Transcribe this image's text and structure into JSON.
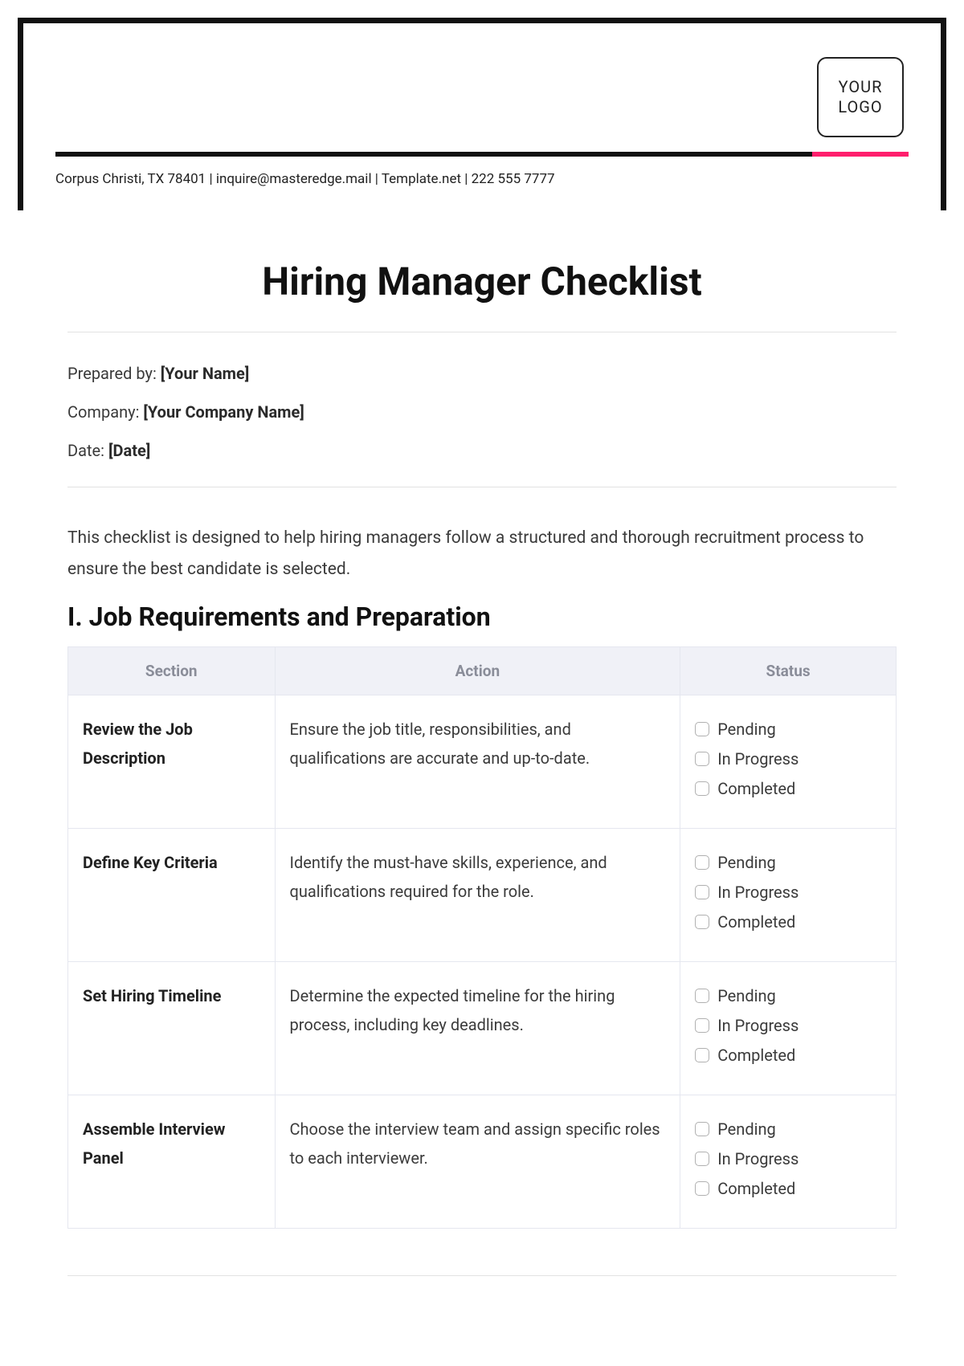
{
  "header": {
    "logo_line1": "YOUR",
    "logo_line2": "LOGO",
    "contact": "Corpus Christi, TX 78401 | inquire@masteredge.mail | Template.net | 222 555 7777"
  },
  "title": "Hiring Manager Checklist",
  "meta": {
    "prepared_label": "Prepared by: ",
    "prepared_value": "[Your Name]",
    "company_label": "Company: ",
    "company_value": "[Your Company Name]",
    "date_label": "Date: ",
    "date_value": "[Date]"
  },
  "intro": "This checklist is designed to help hiring managers follow a structured and thorough recruitment process to ensure the best candidate is selected.",
  "section1": {
    "heading": "I. Job Requirements and Preparation",
    "columns": {
      "section": "Section",
      "action": "Action",
      "status": "Status"
    },
    "status_options": [
      "Pending",
      "In Progress",
      "Completed"
    ],
    "rows": [
      {
        "section": "Review the Job Description",
        "action": "Ensure the job title, responsibilities, and qualifications are accurate and up-to-date."
      },
      {
        "section": "Define Key Criteria",
        "action": "Identify the must-have skills, experience, and qualifications required for the role."
      },
      {
        "section": "Set Hiring Timeline",
        "action": "Determine the expected timeline for the hiring process, including key deadlines."
      },
      {
        "section": "Assemble Interview Panel",
        "action": "Choose the interview team and assign specific roles to each interviewer."
      }
    ]
  }
}
